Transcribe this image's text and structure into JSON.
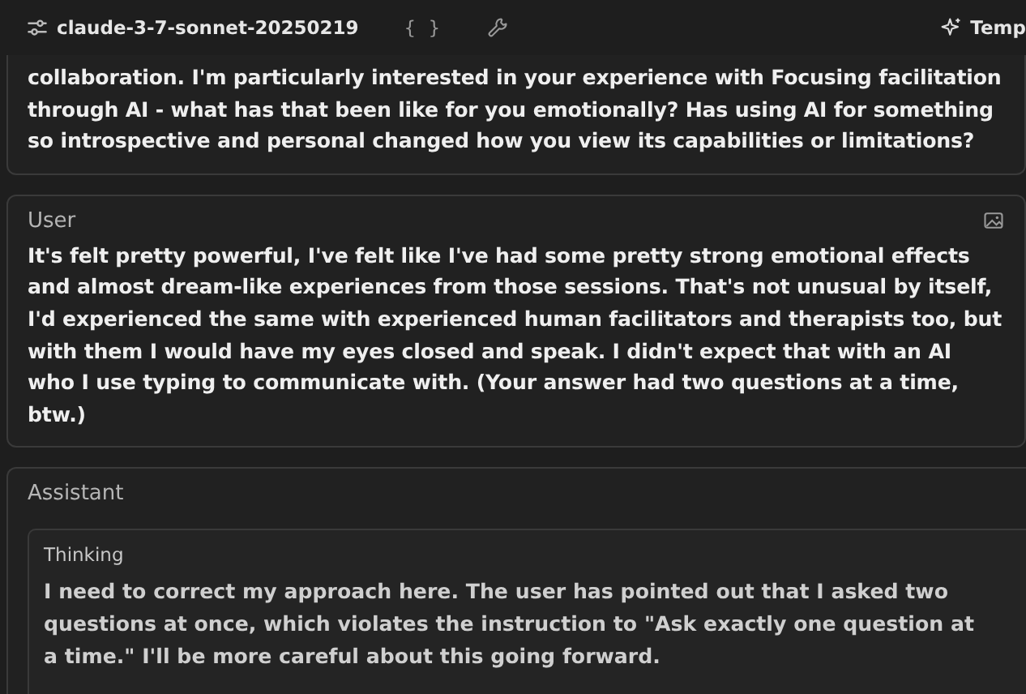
{
  "toolbar": {
    "model": "claude-3-7-sonnet-20250219",
    "json_toggle": "{ }",
    "template_button": "Temp"
  },
  "messages": [
    {
      "kind": "continued",
      "text": "collaboration. I'm particularly interested in your experience with Focusing facilitation through AI - what has that been like for you emotionally? Has using AI for something so introspective and personal changed how you view its capabilities or limitations?"
    },
    {
      "kind": "user",
      "role": "User",
      "text": "It's felt pretty powerful, I've felt like I've had some pretty strong emotional effects and almost dream-like experiences from those sessions. That's not unusual by itself, I'd experienced the same with experienced human facilitators and therapists too, but with them I would have my eyes closed and speak. I didn't expect that with an AI who I use typing to communicate with. (Your answer had two questions at a time, btw.)"
    },
    {
      "kind": "assistant",
      "role": "Assistant",
      "thinking": {
        "label": "Thinking",
        "text": "I need to correct my approach here. The user has pointed out that I asked two questions at once, which violates the instruction to \"Ask exactly one question at a time.\" I'll be more careful about this going forward."
      }
    }
  ]
}
